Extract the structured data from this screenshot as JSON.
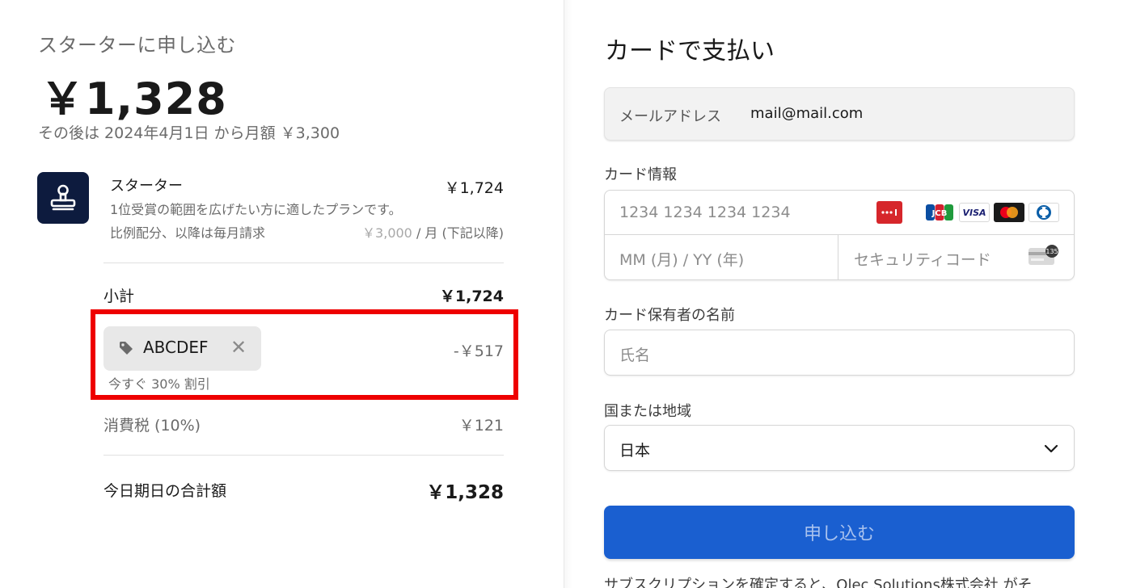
{
  "summary": {
    "plan_title": "スターターに申し込む",
    "total_big": "￥1,328",
    "then_text": "その後は 2024年4月1日 から月額 ￥3,300",
    "product": {
      "name": "スターター",
      "price": "￥1,724",
      "description": "1位受賞の範囲を広げたい方に適したプランです。",
      "prorate_label": "比例配分、以降は毎月請求",
      "prorate_amount": "￥3,000",
      "prorate_suffix": " / 月 (下記以降)"
    },
    "subtotal": {
      "label": "小計",
      "value": "￥1,724"
    },
    "coupon": {
      "code": "ABCDEF",
      "amount": "-￥517",
      "note": "今すぐ 30% 割引"
    },
    "tax": {
      "label": "消費税 (10%)",
      "value": "￥121"
    },
    "total": {
      "label": "今日期日の合計額",
      "value": "￥1,328"
    }
  },
  "payment": {
    "title": "カードで支払い",
    "email": {
      "label": "メールアドレス",
      "value": "mail@mail.com"
    },
    "card": {
      "label": "カード情報",
      "number_placeholder": "1234 1234 1234 1234",
      "expiry_placeholder": "MM (月) / YY (年)",
      "cvc_placeholder": "セキュリティコード",
      "cvc_badge": "135",
      "brands": {
        "jcb": "JCB",
        "visa": "VISA"
      }
    },
    "name": {
      "label": "カード保有者の名前",
      "placeholder": "氏名"
    },
    "country": {
      "label": "国または地域",
      "value": "日本"
    },
    "submit_label": "申し込む",
    "footer": "サブスクリプションを確定すると、Olec Solutions株式会社 がそ"
  },
  "colors": {
    "accent": "#1a5fd0",
    "highlight_box": "#ee0000",
    "product_icon_bg": "#0d1b3e"
  }
}
